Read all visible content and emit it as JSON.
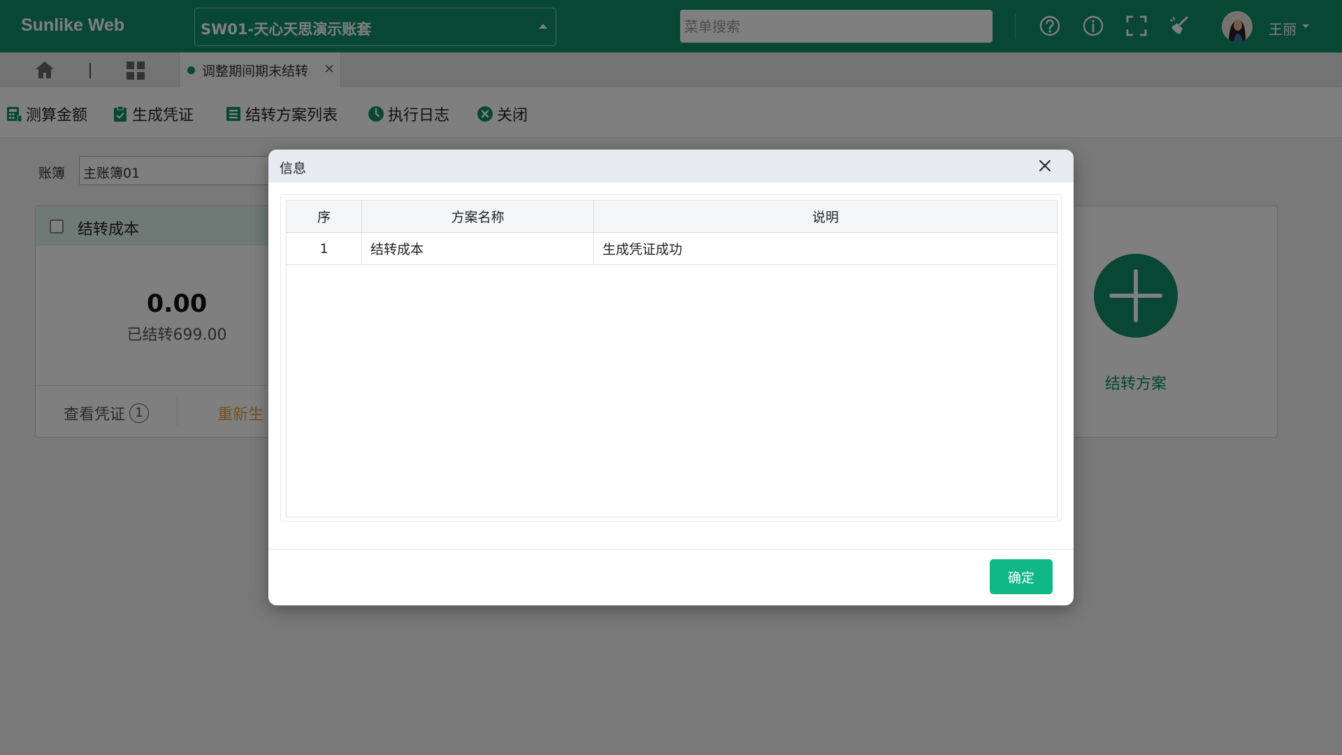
{
  "app": {
    "brand": "Sunlike Web",
    "account_set": "SW01-天心天思演示账套",
    "search_placeholder": "菜单搜索",
    "user_name": "王丽",
    "header_icons": [
      "help-circle-icon",
      "info-circle-icon",
      "fullscreen-icon",
      "broom-clean-icon"
    ],
    "accent_color": "#0e8f68"
  },
  "tabs": {
    "active_label": "调整期间期末结转",
    "close_glyph": "×"
  },
  "toolbar": {
    "calc_amount": "测算金额",
    "gen_voucher": "生成凭证",
    "plan_list": "结转方案列表",
    "exec_log": "执行日志",
    "close": "关闭"
  },
  "main": {
    "book_label": "账簿",
    "book_value": "主账簿01",
    "card": {
      "title": "结转成本",
      "amount": "0.00",
      "transferred": "已结转699.00",
      "view_voucher": "查看凭证",
      "voucher_count": "1",
      "regenerate": "重新生"
    },
    "add_plan_label": "结转方案"
  },
  "dialog": {
    "title": "信息",
    "columns": [
      "序",
      "方案名称",
      "说明"
    ],
    "rows": [
      {
        "no": "1",
        "name": "结转成本",
        "desc": "生成凭证成功"
      }
    ],
    "ok_label": "确定",
    "ok_color": "#10b884"
  }
}
